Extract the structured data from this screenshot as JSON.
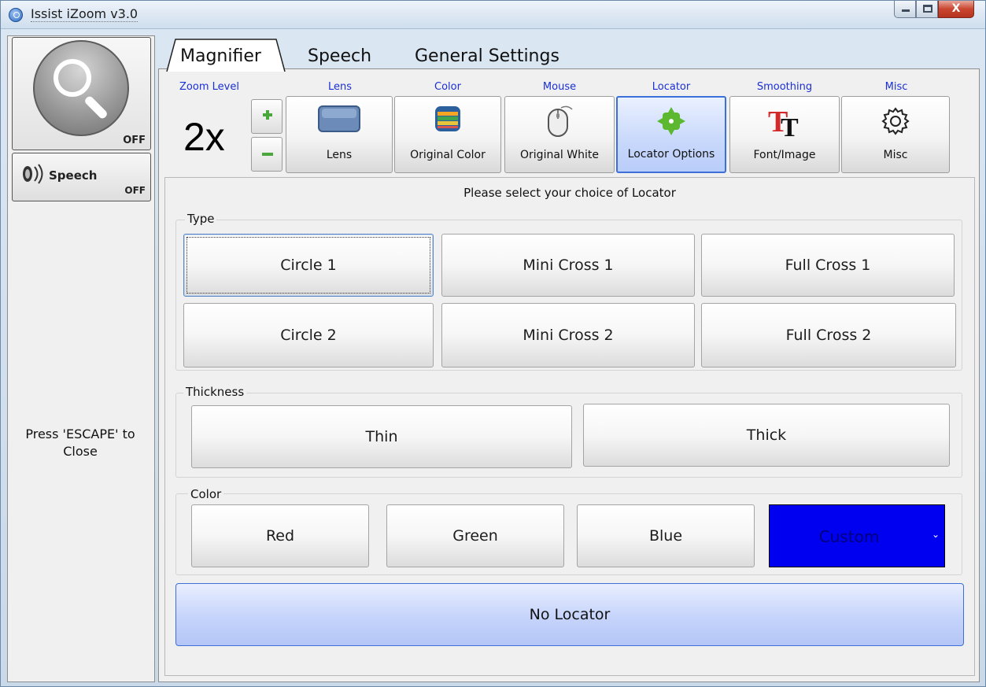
{
  "window": {
    "title": "Issist iZoom v3.0",
    "close_glyph": "X"
  },
  "left": {
    "magnifier_state": "OFF",
    "speech_label": "Speech",
    "speech_state": "OFF",
    "escape_hint": "Press 'ESCAPE' to Close"
  },
  "tabs": [
    "Magnifier",
    "Speech",
    "General Settings"
  ],
  "toolbar": {
    "zoom_label": "Zoom Level",
    "zoom_value": "2x",
    "groups": [
      {
        "label": "Lens",
        "caption": "Lens",
        "icon": "lens-icon"
      },
      {
        "label": "Color",
        "caption": "Original Color",
        "icon": "color-icon"
      },
      {
        "label": "Mouse",
        "caption": "Original  White",
        "icon": "mouse-icon"
      },
      {
        "label": "Locator",
        "caption": "Locator Options",
        "icon": "locator-icon"
      },
      {
        "label": "Smoothing",
        "caption": "Font/Image",
        "icon": "font-smoothing-icon"
      },
      {
        "label": "Misc",
        "caption": "Misc",
        "icon": "gear-icon"
      }
    ]
  },
  "locator": {
    "prompt": "Please select your choice of Locator",
    "type_label": "Type",
    "types": [
      "Circle 1",
      "Mini Cross 1",
      "Full Cross 1",
      "Circle 2",
      "Mini Cross 2",
      "Full Cross 2"
    ],
    "thickness_label": "Thickness",
    "thickness": [
      "Thin",
      "Thick"
    ],
    "color_label": "Color",
    "colors": [
      "Red",
      "Green",
      "Blue"
    ],
    "custom_value": "Custom",
    "no_locator": "No Locator"
  },
  "colors": {
    "accent": "#3d6fd8",
    "custom_swatch": "#0000f0",
    "group_label": "#1a2fd6"
  }
}
